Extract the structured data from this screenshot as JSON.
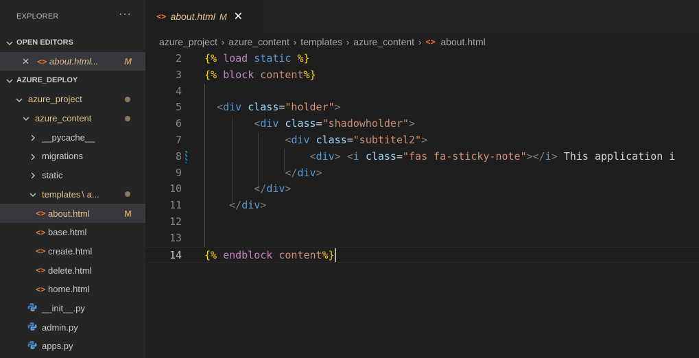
{
  "explorer": {
    "title": "EXPLORER",
    "more": "···",
    "open_editors": {
      "label": "OPEN EDITORS",
      "items": [
        {
          "close": "✕",
          "name": "about.html...",
          "status": "M"
        }
      ]
    },
    "project": {
      "label": "AZURE_DEPLOY",
      "tree": [
        {
          "name": "azure_project",
          "kind": "folder",
          "open": true,
          "dot": true
        },
        {
          "name": "azure_content",
          "kind": "folder",
          "open": true,
          "dot": true
        },
        {
          "name": "__pycache__",
          "kind": "folder",
          "open": false
        },
        {
          "name": "migrations",
          "kind": "folder",
          "open": false
        },
        {
          "name": "static",
          "kind": "folder",
          "open": false
        },
        {
          "name": "templates",
          "suffix": "\\ a...",
          "kind": "folder",
          "open": true,
          "dot": true
        },
        {
          "name": "about.html",
          "kind": "html",
          "status": "M"
        },
        {
          "name": "base.html",
          "kind": "html"
        },
        {
          "name": "create.html",
          "kind": "html"
        },
        {
          "name": "delete.html",
          "kind": "html"
        },
        {
          "name": "home.html",
          "kind": "html"
        },
        {
          "name": "__init__.py",
          "kind": "py"
        },
        {
          "name": "admin.py",
          "kind": "py"
        },
        {
          "name": "apps.py",
          "kind": "py"
        }
      ]
    }
  },
  "tab": {
    "icon": "<>",
    "label": "about.html",
    "status": "M",
    "close": "✕"
  },
  "breadcrumb": [
    "azure_project",
    "azure_content",
    "templates",
    "azure_content",
    "about.html"
  ],
  "editor": {
    "lines": [
      {
        "n": "2",
        "text": "{% load static %}"
      },
      {
        "n": "3",
        "text": "{% block content%}"
      },
      {
        "n": "4",
        "text": ""
      },
      {
        "n": "5",
        "text": "  <div class=\"holder\">"
      },
      {
        "n": "6",
        "text": "        <div class=\"shadowholder\">"
      },
      {
        "n": "7",
        "text": "             <div class=\"subtitel2\">"
      },
      {
        "n": "8",
        "text": "                 <div> <i class=\"fas fa-sticky-note\"></i> This application i"
      },
      {
        "n": "9",
        "text": "             </div>"
      },
      {
        "n": "10",
        "text": "        </div>"
      },
      {
        "n": "11",
        "text": "    </div>"
      },
      {
        "n": "12",
        "text": ""
      },
      {
        "n": "13",
        "text": ""
      },
      {
        "n": "14",
        "text": "{% endblock content%}"
      }
    ]
  },
  "colors": {
    "accent_modified": "#e2c08d",
    "html_icon": "#e37933",
    "tag": "#569cd6",
    "attribute": "#9cdcfe",
    "string": "#ce9178",
    "template_delim": "#ffd700",
    "template_keyword": "#c586c0"
  }
}
